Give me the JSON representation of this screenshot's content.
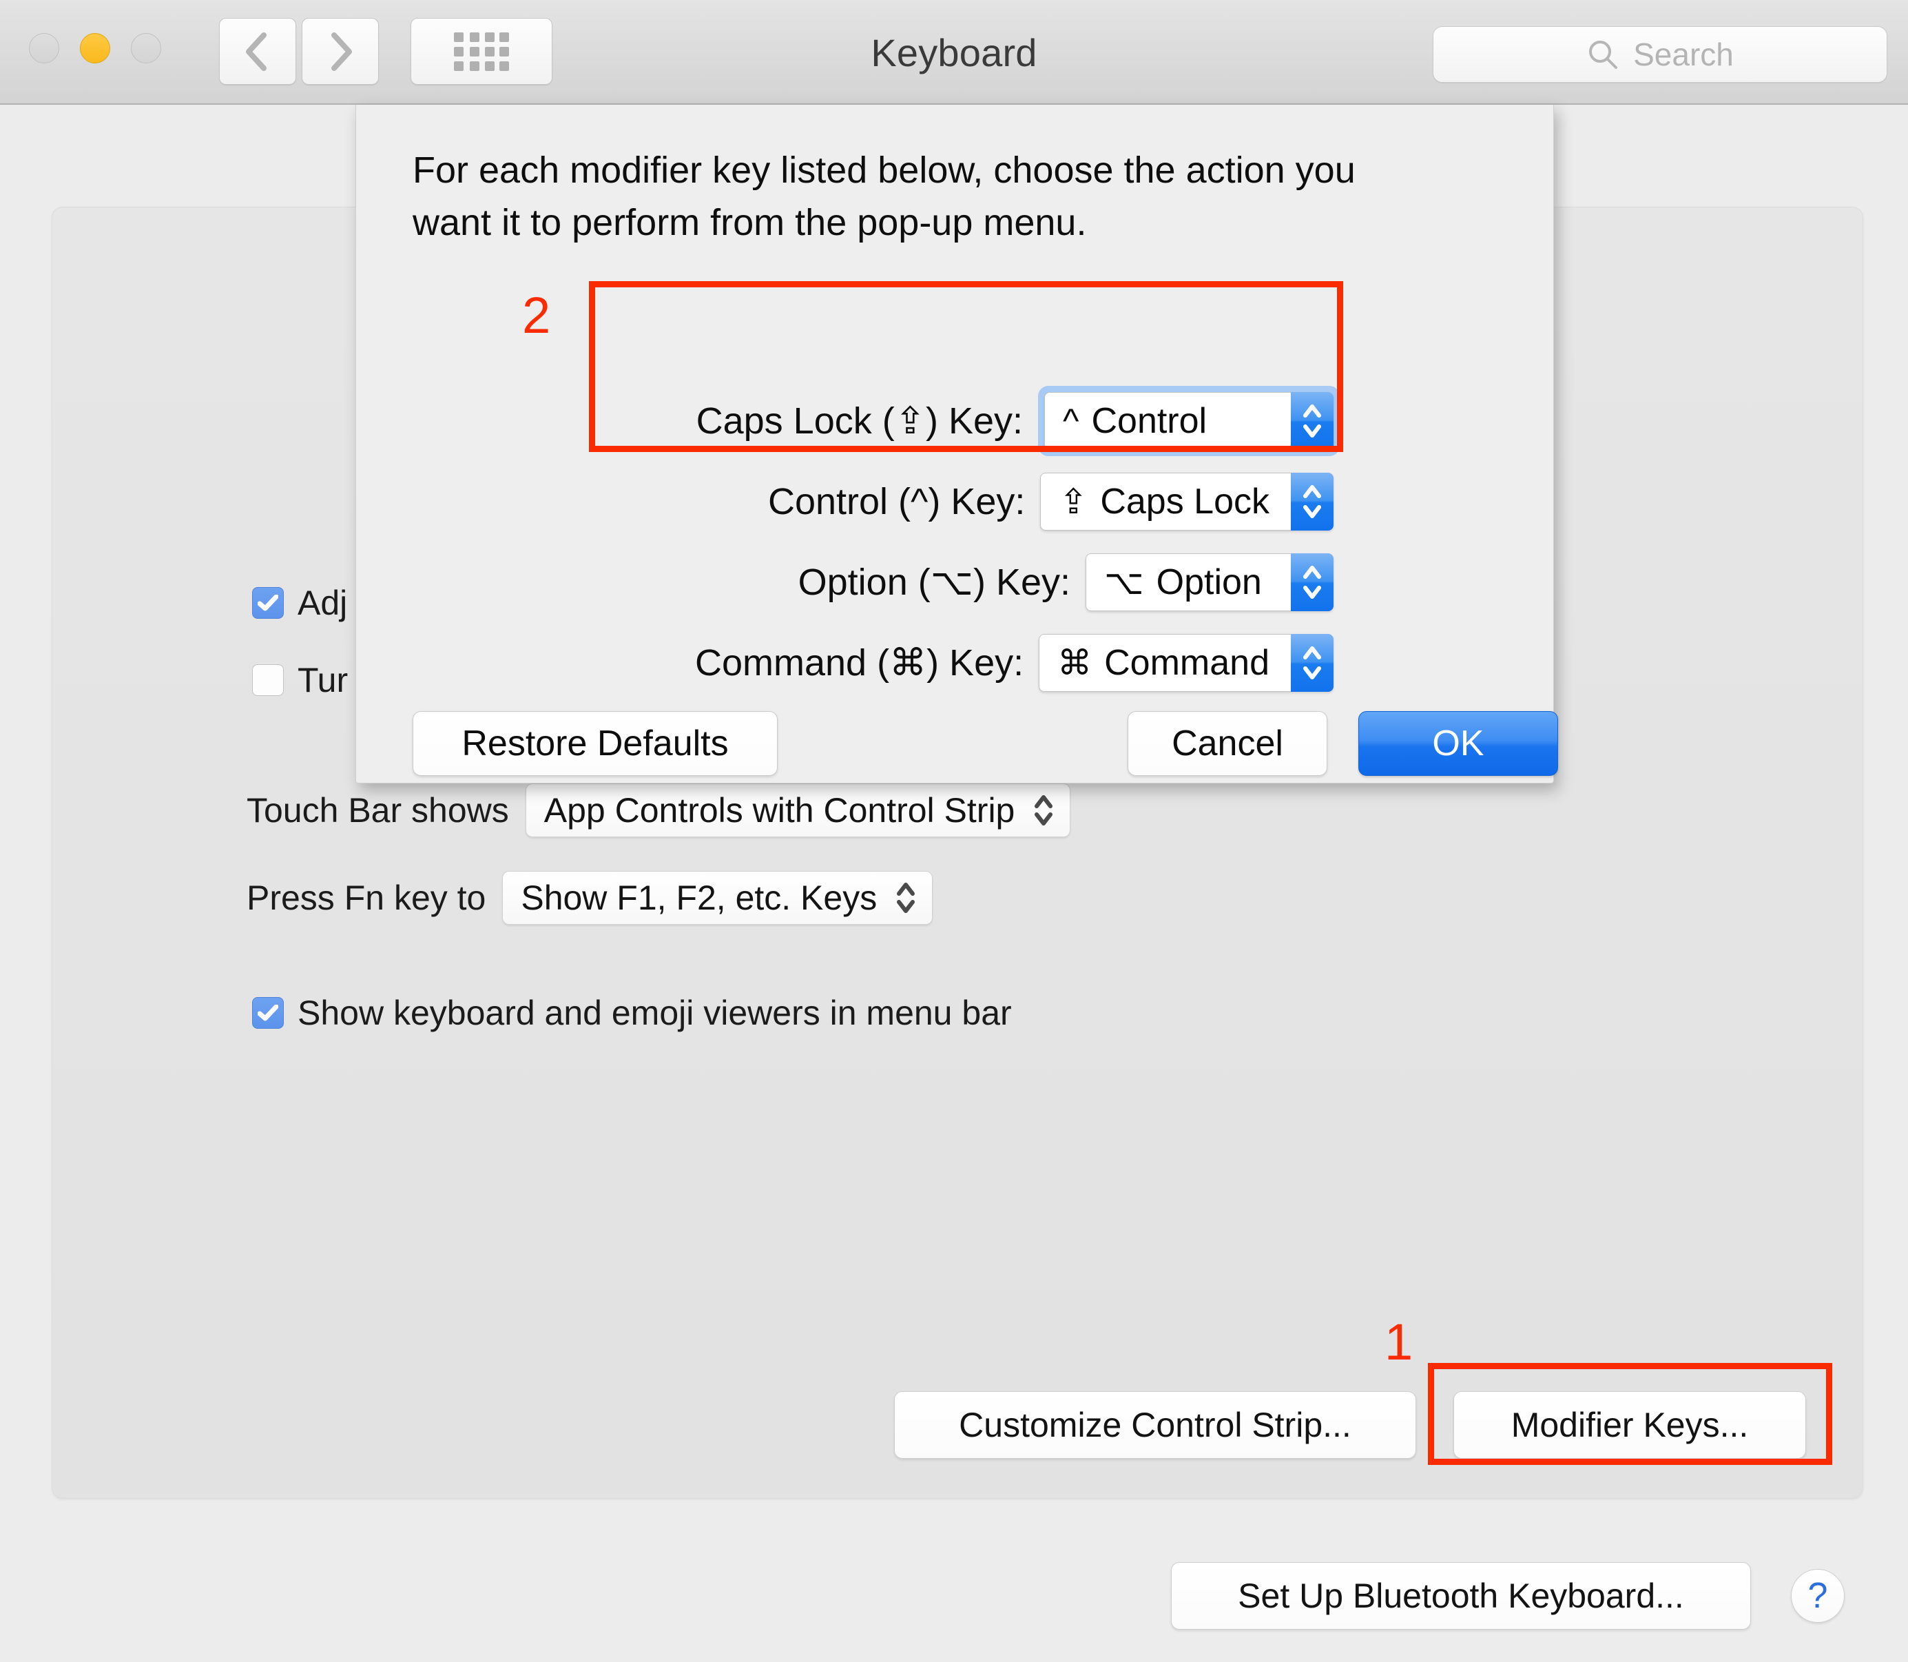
{
  "window": {
    "title": "Keyboard",
    "traffic_lights": [
      {
        "name": "close",
        "state": "disabled"
      },
      {
        "name": "minimize",
        "state": "enabled",
        "color": "#fbb91c"
      },
      {
        "name": "zoom",
        "state": "disabled"
      }
    ],
    "toolbar": {
      "back_icon": "chevron-left-icon",
      "forward_icon": "chevron-right-icon",
      "show_all_icon": "grid-icon"
    },
    "search": {
      "icon": "search-icon",
      "placeholder": "Search",
      "value": ""
    }
  },
  "background_pane": {
    "checkboxes": [
      {
        "label": "Adj",
        "checked": true,
        "occluded": true
      },
      {
        "label": "Tur",
        "checked": false,
        "occluded": true
      },
      {
        "label": "Show keyboard and emoji viewers in menu bar",
        "checked": true,
        "occluded": false
      }
    ],
    "option_rows": [
      {
        "label": "Touch Bar shows",
        "value": "App Controls with Control Strip"
      },
      {
        "label": "Press Fn key to",
        "value": "Show F1, F2, etc. Keys"
      }
    ],
    "buttons": {
      "customize_control_strip": "Customize Control Strip...",
      "modifier_keys": "Modifier Keys...",
      "set_up_bluetooth_keyboard": "Set Up Bluetooth Keyboard...",
      "help": "?"
    }
  },
  "sheet": {
    "instructions": "For each modifier key listed below, choose the action you want it to perform from the pop-up menu.",
    "rows": [
      {
        "label": "Caps Lock (⇪) Key:",
        "glyph": "^",
        "value": "Control",
        "focused": true
      },
      {
        "label": "Control (^) Key:",
        "glyph": "⇪",
        "value": "Caps Lock",
        "focused": false
      },
      {
        "label": "Option (⌥) Key:",
        "glyph": "⌥",
        "value": "Option",
        "focused": false
      },
      {
        "label": "Command (⌘) Key:",
        "glyph": "⌘",
        "value": "Command",
        "focused": false
      }
    ],
    "buttons": {
      "restore_defaults": "Restore Defaults",
      "cancel": "Cancel",
      "ok": "OK"
    }
  },
  "annotations": {
    "color": "#fa2b00",
    "markers": [
      {
        "label": "1",
        "target": "modifier-keys-button"
      },
      {
        "label": "2",
        "target": "caps-lock-and-control-rows"
      }
    ]
  }
}
